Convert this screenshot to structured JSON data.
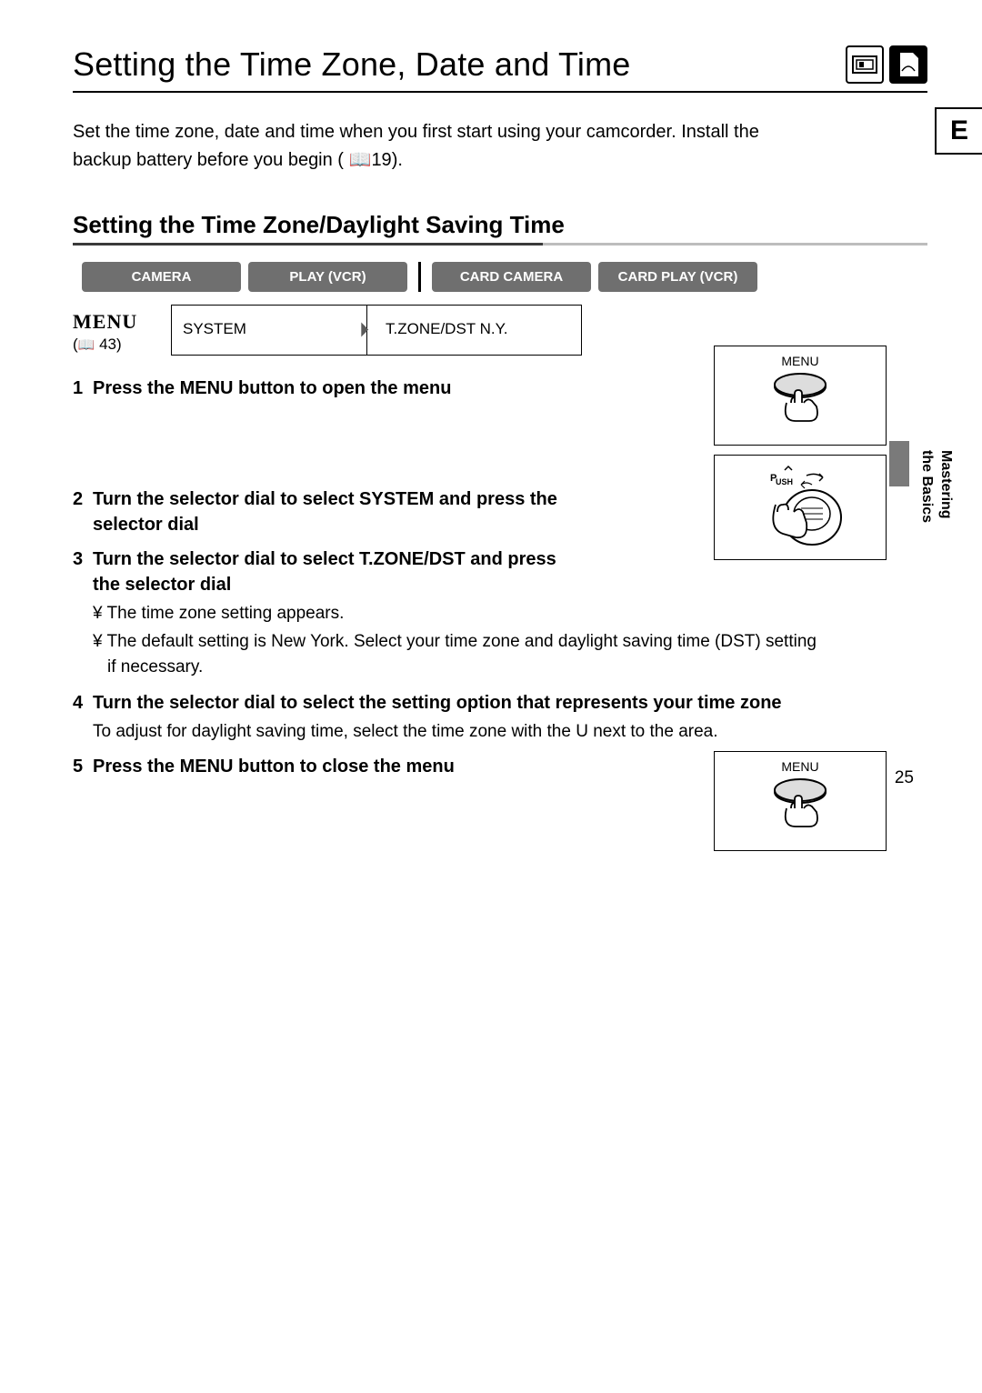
{
  "title": "Setting the Time Zone, Date and Time",
  "intro_line1": "Set the time zone, date and time when you first start using your camcorder. Install the",
  "intro_line2_prefix": "backup battery before you begin (",
  "intro_book_ref": "19",
  "intro_line2_suffix": ").",
  "side_tab": "E",
  "side_vertical_1": "Mastering",
  "side_vertical_2": "the Basics",
  "section_title": "Setting the Time Zone/Daylight Saving Time",
  "modes": [
    "CAMERA",
    "PLAY (VCR)",
    "CARD CAMERA",
    "CARD PLAY (VCR)"
  ],
  "menu_label": "MENU",
  "menu_ref_num": "43",
  "menu_box1": "SYSTEM",
  "menu_box2": "T.ZONE/DST  N.Y.",
  "illus_menu_caption": "MENU",
  "illus_push_caption": "PUSH",
  "steps": [
    {
      "n": "1",
      "head": "Press the MENU button to open the menu",
      "wide": false
    },
    {
      "n": "2",
      "head": "Turn the selector dial to select  SYSTEM  and press the selector dial",
      "wide": false
    },
    {
      "n": "3",
      "head": "Turn the selector dial to select  T.ZONE/DST  and press the selector dial",
      "wide": false,
      "bullets": [
        "The time zone setting appears.",
        "The default setting is New York. Select your time zone and daylight saving time (DST) setting if necessary."
      ]
    },
    {
      "n": "4",
      "head": "Turn the selector dial to select the setting option that represents your time zone",
      "wide": true,
      "body": "To adjust for daylight saving time, select the time zone with the U next to the area."
    },
    {
      "n": "5",
      "head": "Press the MENU button to close the menu",
      "wide": false
    }
  ],
  "page_number": "25"
}
